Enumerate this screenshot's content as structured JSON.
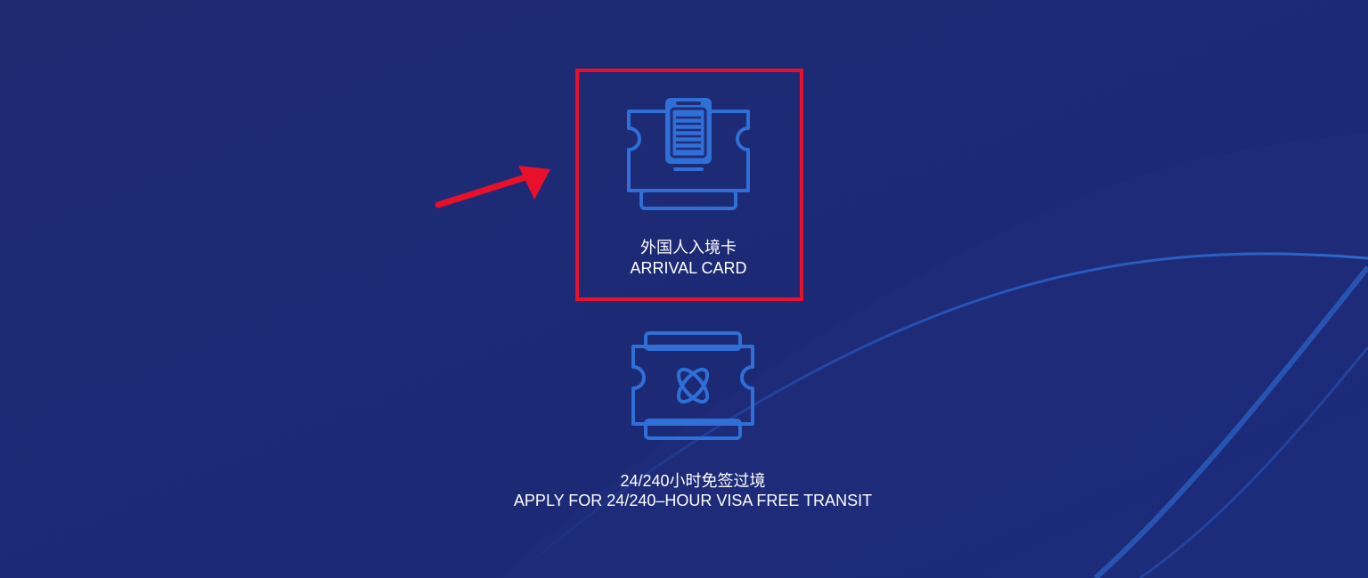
{
  "background": {
    "color": "#1f2d77",
    "accent": "#2f6fd6"
  },
  "annotation": {
    "highlight_color": "#e8102a",
    "arrow_color": "#e8102a"
  },
  "cards": [
    {
      "icon": "arrival-card-ticket-icon",
      "label_zh": "外国人入境卡",
      "label_en": "ARRIVAL CARD"
    },
    {
      "icon": "visa-free-transit-ticket-icon",
      "label_zh": "24/240小时免签过境",
      "label_en": "APPLY FOR 24/240–HOUR VISA FREE TRANSIT"
    }
  ]
}
